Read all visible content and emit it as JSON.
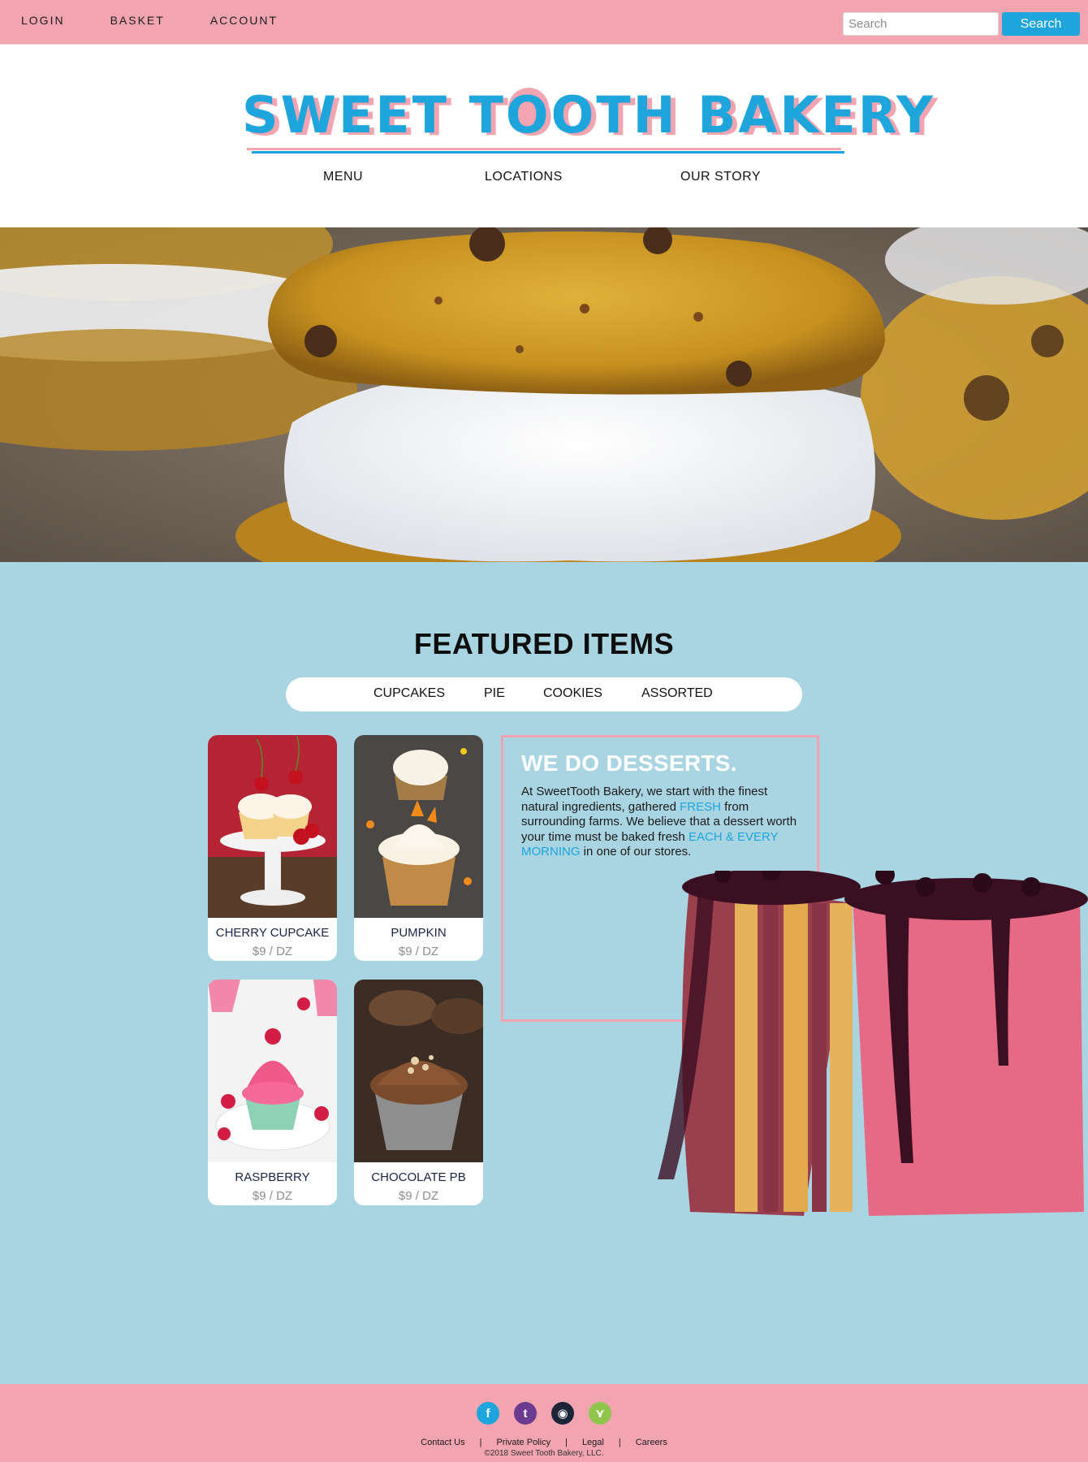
{
  "topbar": {
    "links": [
      "LOGIN",
      "BASKET",
      "ACCOUNT"
    ],
    "search_placeholder": "Search",
    "search_button": "Search"
  },
  "brand": {
    "logo_text": "SWEET TOOTH BAKERY",
    "colors": {
      "pink": "#f2a5b1",
      "blue": "#1ea5dc",
      "section_bg": "#a9d5e3"
    }
  },
  "mainnav": [
    "MENU",
    "LOCATIONS",
    "OUR STORY"
  ],
  "featured": {
    "title": "FEATURED ITEMS",
    "tabs": [
      "CUPCAKES",
      "PIE",
      "COOKIES",
      "ASSORTED"
    ],
    "items": [
      {
        "name": "CHERRY CUPCAKE",
        "price": "$9 / DZ"
      },
      {
        "name": "PUMPKIN",
        "price": "$9 / DZ"
      },
      {
        "name": "RASPBERRY",
        "price": "$9 / DZ"
      },
      {
        "name": "CHOCOLATE PB",
        "price": "$9 / DZ"
      }
    ],
    "about": {
      "heading": "WE DO DESSERTS.",
      "text_1": "At SweetTooth Bakery, we start with the finest natural ingredients, gathered ",
      "highlight_1": "FRESH",
      "text_2": " from surrounding farms. We believe that a dessert worth your time must be baked fresh ",
      "highlight_2": "EACH & EVERY MORNING",
      "text_3": " in one of our stores."
    }
  },
  "footer": {
    "social_icons": [
      "facebook-icon",
      "twitter-icon",
      "instagram-icon",
      "share-icon"
    ],
    "links": [
      "Contact Us",
      "Private Policy",
      "Legal",
      "Careers"
    ],
    "separator": "|",
    "copyright": "©2018 Sweet Tooth Bakery, LLC."
  }
}
